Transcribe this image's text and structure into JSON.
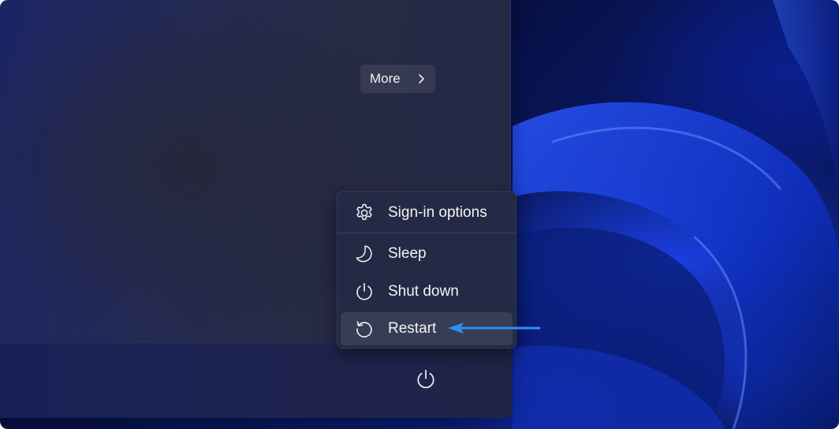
{
  "start_menu": {
    "more_label": "More"
  },
  "power_menu": {
    "items": [
      {
        "label": "Sign-in options",
        "icon": "gear-icon"
      },
      {
        "label": "Sleep",
        "icon": "moon-icon"
      },
      {
        "label": "Shut down",
        "icon": "power-icon"
      },
      {
        "label": "Restart",
        "icon": "restart-icon"
      }
    ],
    "highlighted": "Restart"
  },
  "footer": {
    "power_icon": "power-icon"
  },
  "annotation": {
    "arrow_color": "#2f8ff0"
  },
  "colors": {
    "menu_bg": "#242a45",
    "text": "#f4f4f4",
    "wallpaper_accent": "#1a3fe0"
  }
}
